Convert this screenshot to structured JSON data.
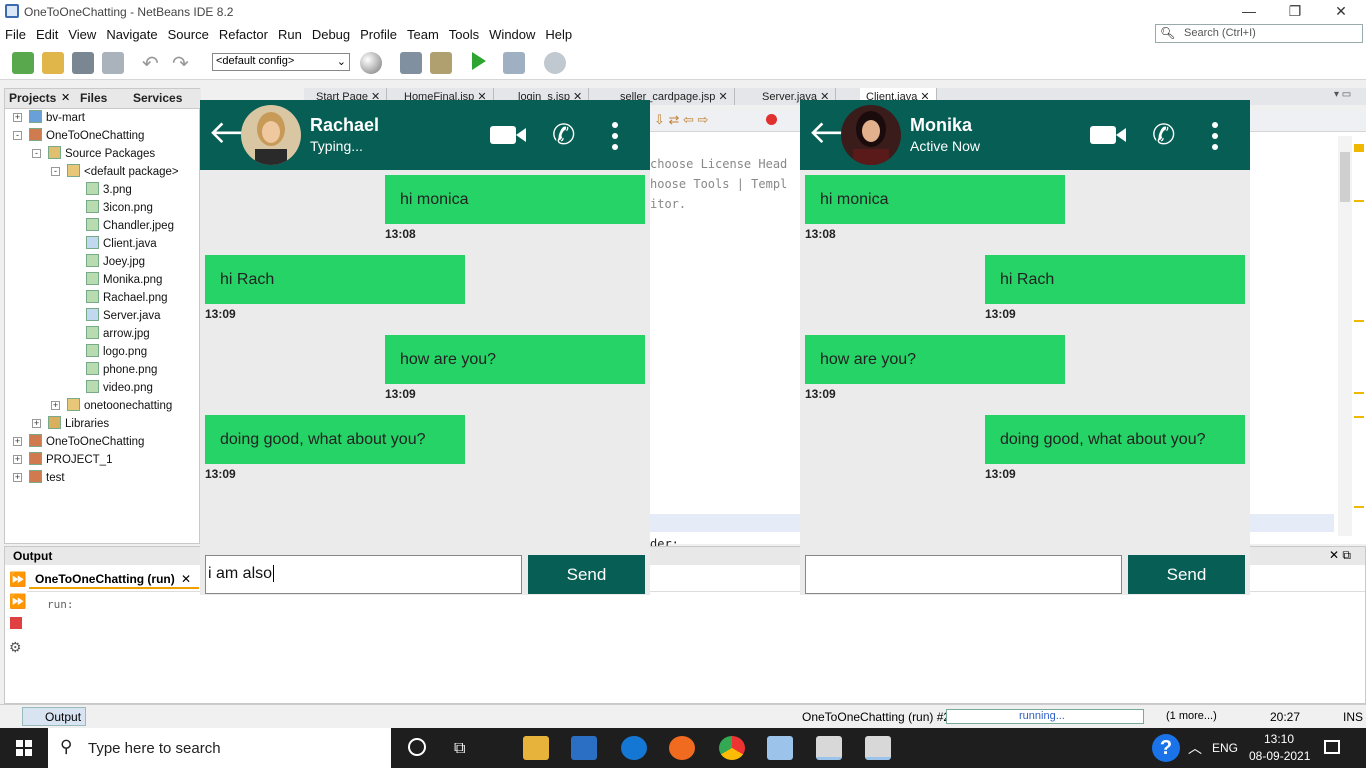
{
  "window": {
    "title": "OneToOneChatting - NetBeans IDE 8.2"
  },
  "menu": [
    "File",
    "Edit",
    "View",
    "Navigate",
    "Source",
    "Refactor",
    "Run",
    "Debug",
    "Profile",
    "Team",
    "Tools",
    "Window",
    "Help"
  ],
  "ide_search": {
    "placeholder": "Search (Ctrl+I)"
  },
  "toolbar": {
    "config": "<default config>"
  },
  "left_panel": {
    "tabs": [
      "Projects",
      "Files",
      "Services"
    ],
    "tree": [
      {
        "label": "bv-mart",
        "level": 0,
        "icon": "globe-icon",
        "expander": "+"
      },
      {
        "label": "OneToOneChatting",
        "level": 0,
        "icon": "coffee-cup-icon",
        "expander": "-"
      },
      {
        "label": "Source Packages",
        "level": 1,
        "icon": "package-folder-icon",
        "expander": "-"
      },
      {
        "label": "<default package>",
        "level": 2,
        "icon": "package-icon",
        "expander": "-"
      },
      {
        "label": "3.png",
        "level": 3,
        "icon": "image-file-icon"
      },
      {
        "label": "3icon.png",
        "level": 3,
        "icon": "image-file-icon"
      },
      {
        "label": "Chandler.jpeg",
        "level": 3,
        "icon": "image-file-icon"
      },
      {
        "label": "Client.java",
        "level": 3,
        "icon": "java-file-icon"
      },
      {
        "label": "Joey.jpg",
        "level": 3,
        "icon": "image-file-icon"
      },
      {
        "label": "Monika.png",
        "level": 3,
        "icon": "image-file-icon"
      },
      {
        "label": "Rachael.png",
        "level": 3,
        "icon": "image-file-icon"
      },
      {
        "label": "Server.java",
        "level": 3,
        "icon": "java-file-icon"
      },
      {
        "label": "arrow.jpg",
        "level": 3,
        "icon": "image-file-icon"
      },
      {
        "label": "logo.png",
        "level": 3,
        "icon": "image-file-icon"
      },
      {
        "label": "phone.png",
        "level": 3,
        "icon": "image-file-icon"
      },
      {
        "label": "video.png",
        "level": 3,
        "icon": "image-file-icon"
      },
      {
        "label": "onetoonechatting",
        "level": 2,
        "icon": "package-icon",
        "expander": "+"
      },
      {
        "label": "Libraries",
        "level": 1,
        "icon": "library-icon",
        "expander": "+"
      },
      {
        "label": "OneToOneChatting",
        "level": 0,
        "icon": "coffee-cup-icon",
        "expander": "+"
      },
      {
        "label": "PROJECT_1",
        "level": 0,
        "icon": "coffee-cup-icon",
        "expander": "+"
      },
      {
        "label": "test",
        "level": 0,
        "icon": "coffee-cup-icon",
        "expander": "+"
      }
    ]
  },
  "editor_tabs": [
    "Start Page",
    "HomeFinal.jsp",
    "login_s.jsp",
    "seller_cardpage.jsp",
    "Server.java",
    "Client.java"
  ],
  "editor_lines": [
    "choose License Head",
    "hoose Tools | Templ",
    "itor."
  ],
  "editor_bottom": "der:",
  "output": {
    "title": "Output",
    "tab": "OneToOneChatting (run)",
    "text": "run:"
  },
  "status": {
    "bottom_tab": "Output",
    "process": "OneToOneChatting (run) #2",
    "progress_text": "running...",
    "more": "(1 more...)",
    "position": "20:27",
    "mode": "INS"
  },
  "taskbar": {
    "search_placeholder": "Type here to search",
    "lang": "ENG",
    "time": "13:10",
    "date": "08-09-2021"
  },
  "chat_left": {
    "name": "Rachael",
    "status": "Typing...",
    "messages": [
      {
        "text": "hi monica",
        "time": "13:08",
        "side": "right"
      },
      {
        "text": "hi Rach",
        "time": "13:09",
        "side": "left"
      },
      {
        "text": "how are you?",
        "time": "13:09",
        "side": "right"
      },
      {
        "text": "doing good, what about you?",
        "time": "13:09",
        "side": "left"
      }
    ],
    "input_value": "i am also",
    "send_label": "Send"
  },
  "chat_right": {
    "name": "Monika",
    "status": "Active Now",
    "messages": [
      {
        "text": "hi monica",
        "time": "13:08",
        "side": "left"
      },
      {
        "text": "hi Rach",
        "time": "13:09",
        "side": "right"
      },
      {
        "text": "how are you?",
        "time": "13:09",
        "side": "left"
      },
      {
        "text": "doing good, what about you?",
        "time": "13:09",
        "side": "right"
      }
    ],
    "input_value": "",
    "send_label": "Send"
  }
}
